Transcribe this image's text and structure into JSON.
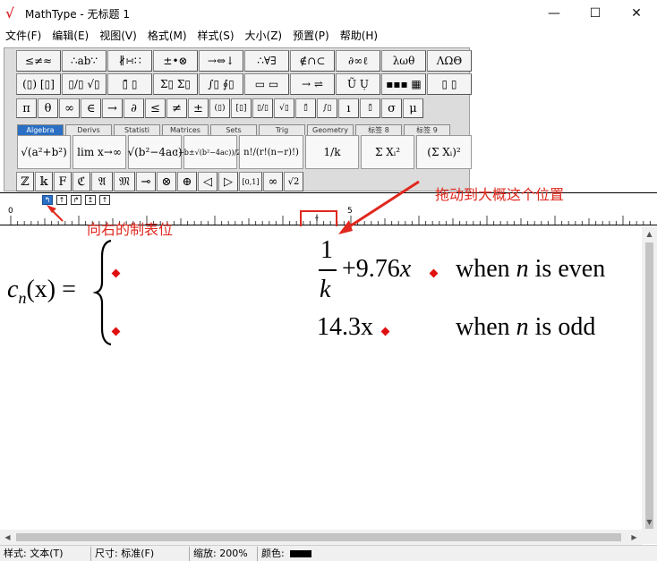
{
  "window": {
    "title": "MathType - 无标题 1",
    "logo_icon": "mathtype-logo-icon",
    "minimize_glyph": "—",
    "maximize_glyph": "☐",
    "close_glyph": "✕"
  },
  "menu": [
    "文件(F)",
    "编辑(E)",
    "视图(V)",
    "格式(M)",
    "样式(S)",
    "大小(Z)",
    "预置(P)",
    "帮助(H)"
  ],
  "palette_row1": [
    "≤≠≈",
    "∴ab∵",
    "∦∺∷",
    "±•⊗",
    "→⇔↓",
    "∴∀∃",
    "∉∩⊂",
    "∂∞ℓ",
    "λωθ",
    "ΛΩΘ"
  ],
  "palette_row2": [
    "(▯) [▯]",
    "▯/▯ √▯",
    "▯̄ ▯",
    "Σ▯ Σ▯",
    "∫▯ ∮▯",
    "▭ ▭",
    "→ ⇌",
    "Ũ Ụ",
    "▪▪▪ ▦",
    "▯ ▯"
  ],
  "symbols_row": [
    "π",
    "θ",
    "∞",
    "∈",
    "→",
    "∂",
    "≤",
    "≠",
    "±",
    "(▯)",
    "[▯]",
    "▯/▯",
    "√▯",
    "▯̄",
    "∫▯",
    "ı",
    "▯̄",
    "σ",
    "μ"
  ],
  "tabs": [
    "Algebra",
    "Derivs",
    "Statisti",
    "Matrices",
    "Sets",
    "Trig",
    "Geometry",
    "标签 8",
    "标签 9"
  ],
  "active_tab": "Algebra",
  "templates": [
    "√(a²+b²)",
    "lim x→∞",
    "√(b²−4ac)",
    "(−b±√(b²−4ac))/2a",
    "n!/(r!(n−r)!)",
    "1/k",
    "Σ Xᵢ²",
    "(Σ Xᵢ)²"
  ],
  "templates_row2": [
    "ℤ",
    "𝕜",
    "F",
    "ℭ",
    "𝔄",
    "𝔐",
    "⊸",
    "⊗",
    "⊕",
    "◁",
    "▷",
    "[0,1]",
    "∞",
    "√2"
  ],
  "tabstop_buttons": [
    "↰",
    "↑",
    "↱",
    "↥",
    "↑"
  ],
  "ruler": {
    "marks": [
      "0",
      "5"
    ],
    "tab_marker_glyph": "ɫ"
  },
  "equation": {
    "lhs_c": "c",
    "lhs_sub": "n",
    "lhs_rest": "(x) =",
    "brace": "{",
    "row1_numerator": "1",
    "row1_denominator": "k",
    "row1_expr": "+9.76",
    "row1_var": "x",
    "row1_condition_pre": "when",
    "row1_condition_var": "n",
    "row1_condition_post": "is even",
    "row2_expr": "14.3x",
    "row2_condition_pre": "when",
    "row2_condition_var": "n",
    "row2_condition_post": "is odd"
  },
  "annotations": {
    "drag_note": "拖动到大概这个位置",
    "right_tab_note": "向右的制表位",
    "color": "#e0281e"
  },
  "status": {
    "style": "样式: 文本(T)",
    "size": "尺寸: 标准(F)",
    "zoom": "缩放: 200%",
    "color_label": "颜色:"
  }
}
